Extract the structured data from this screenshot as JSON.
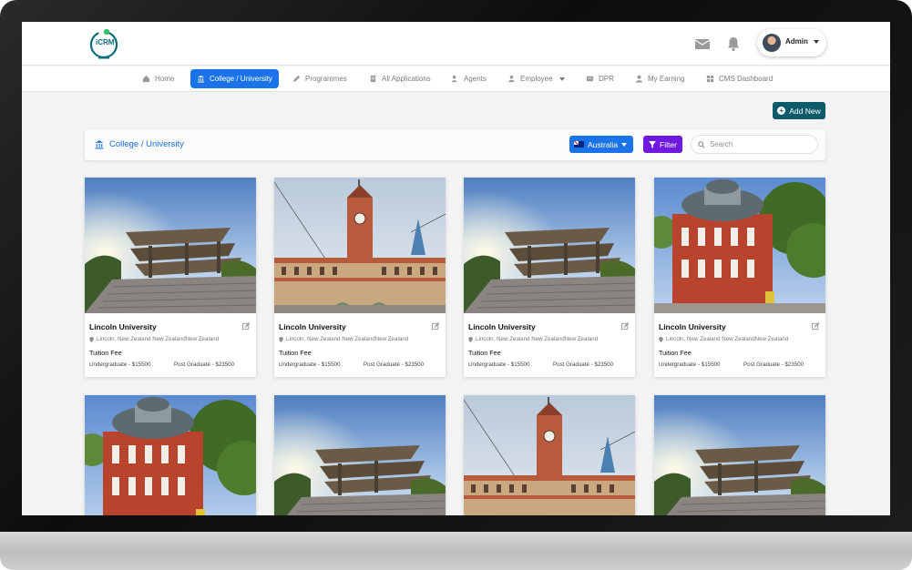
{
  "header": {
    "logo_text": "iCRM",
    "mail_icon": "mail-icon",
    "bell_icon": "bell-icon",
    "user_label": "Admin"
  },
  "nav": {
    "items": [
      {
        "label": "Home",
        "icon": "home-icon"
      },
      {
        "label": "College / University",
        "icon": "university-icon",
        "active": true
      },
      {
        "label": "Programmes",
        "icon": "pen-icon"
      },
      {
        "label": "All Applications",
        "icon": "document-icon"
      },
      {
        "label": "Agents",
        "icon": "agent-icon"
      },
      {
        "label": "Employee",
        "icon": "employee-icon",
        "dropdown": true
      },
      {
        "label": "DPR",
        "icon": "dpr-icon"
      },
      {
        "label": "My Earning",
        "icon": "user-icon"
      },
      {
        "label": "CMS Dashboard",
        "icon": "dashboard-icon"
      }
    ]
  },
  "actions": {
    "add_new_label": "Add New"
  },
  "toolbar": {
    "title": "College / University",
    "country_label": "Australia",
    "filter_label": "Filter",
    "search_placeholder": "Search"
  },
  "colors": {
    "primary": "#1a73e8",
    "teal": "#0d5a6b",
    "filter": "#6f18e0"
  },
  "cards": [
    {
      "name": "Lincoln University",
      "location": "Lincoln, New Zealand New ZealandNew Zealand",
      "fee_label": "Tuition Fee",
      "undergraduate": "Undergraduate -  $15500",
      "postgraduate": "Post Graduate -  $23500",
      "image": "modern-building"
    },
    {
      "name": "Lincoln University",
      "location": "Lincoln, New Zealand New ZealandNew Zealand",
      "fee_label": "Tuition Fee",
      "undergraduate": "Undergraduate -  $15500",
      "postgraduate": "Post Graduate -  $23500",
      "image": "clock-tower"
    },
    {
      "name": "Lincoln University",
      "location": "Lincoln, New Zealand New ZealandNew Zealand",
      "fee_label": "Tuition Fee",
      "undergraduate": "Undergraduate -  $15500",
      "postgraduate": "Post Graduate -  $23500",
      "image": "modern-building"
    },
    {
      "name": "Lincoln University",
      "location": "Lincoln, New Zealand New ZealandNew Zealand",
      "fee_label": "Tuition Fee",
      "undergraduate": "Undergraduate -  $15500",
      "postgraduate": "Post Graduate -  $23500",
      "image": "red-theatre"
    },
    {
      "image": "red-theatre"
    },
    {
      "image": "modern-building"
    },
    {
      "image": "clock-tower"
    },
    {
      "image": "modern-building"
    }
  ]
}
